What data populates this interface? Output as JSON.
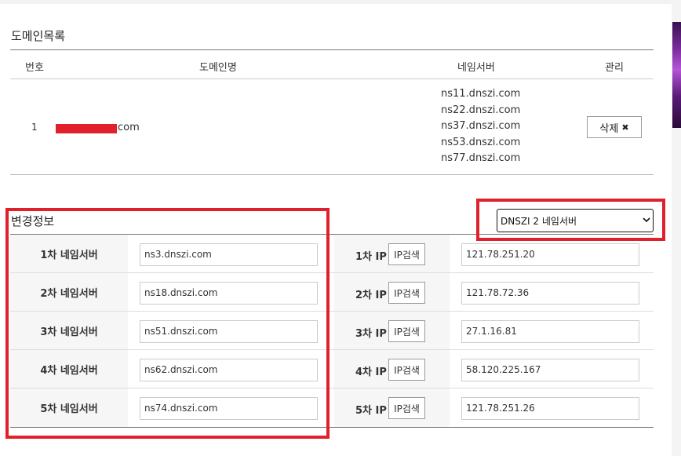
{
  "domain_list": {
    "title": "도메인목록",
    "headers": {
      "num": "번호",
      "domain": "도메인명",
      "nameserver": "네임서버",
      "manage": "관리"
    },
    "row": {
      "num": "1",
      "domain_suffix": "com",
      "nameservers": [
        "ns11.dnszi.com",
        "ns22.dnszi.com",
        "ns37.dnszi.com",
        "ns53.dnszi.com",
        "ns77.dnszi.com"
      ],
      "delete_label": "삭제",
      "delete_icon": "✖"
    }
  },
  "change_info": {
    "title": "변경정보",
    "select_value": "DNSZI 2 네임서버",
    "ip_search_label": "IP검색",
    "rows": [
      {
        "label": "1차 네임서버",
        "ns": "ns3.dnszi.com",
        "ip_label": "1차 IP",
        "ip": "121.78.251.20"
      },
      {
        "label": "2차 네임서버",
        "ns": "ns18.dnszi.com",
        "ip_label": "2차 IP",
        "ip": "121.78.72.36"
      },
      {
        "label": "3차 네임서버",
        "ns": "ns51.dnszi.com",
        "ip_label": "3차 IP",
        "ip": "27.1.16.81"
      },
      {
        "label": "4차 네임서버",
        "ns": "ns62.dnszi.com",
        "ip_label": "4차 IP",
        "ip": "58.120.225.167"
      },
      {
        "label": "5차 네임서버",
        "ns": "ns74.dnszi.com",
        "ip_label": "5차 IP",
        "ip": "121.78.251.26"
      }
    ]
  },
  "colors": {
    "highlight": "#e0202a",
    "redaction": "#e0202a"
  },
  "icons": {
    "delete": "close-icon",
    "select_arrow": "chevron-down-icon"
  }
}
